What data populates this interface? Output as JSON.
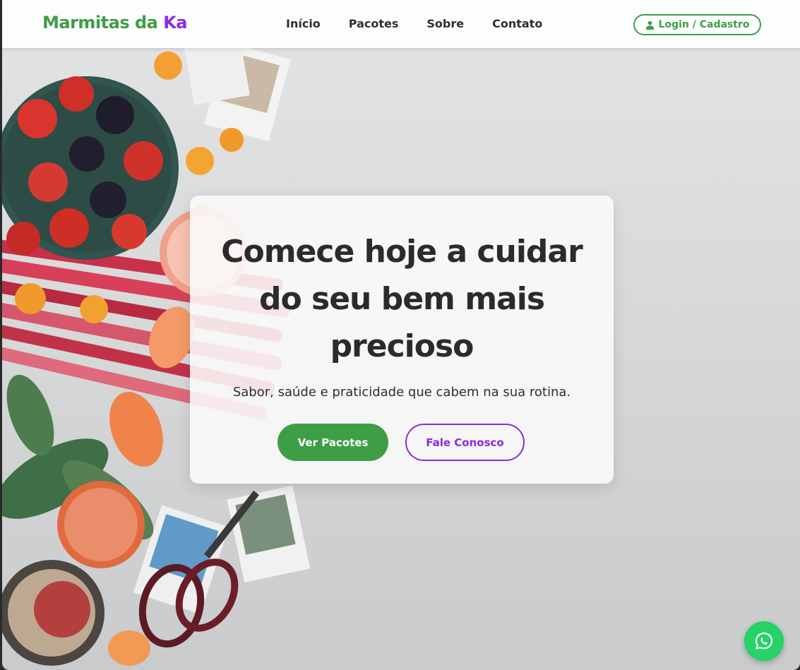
{
  "brand": {
    "name_part1": "Marmitas da ",
    "name_part2": "Ka"
  },
  "nav": {
    "links": [
      "Início",
      "Pacotes",
      "Sobre",
      "Contato"
    ],
    "login_label": "Login / Cadastro"
  },
  "hero": {
    "title": "Comece hoje a cuidar do seu bem mais precioso",
    "subtitle": "Sabor, saúde e praticidade que cabem na sua rotina.",
    "primary_cta": "Ver Pacotes",
    "secondary_cta": "Fale Conosco"
  },
  "floating": {
    "whatsapp_icon": "whatsapp-icon"
  },
  "colors": {
    "brand_green": "#3e9e46",
    "brand_purple": "#8a2be2",
    "whatsapp_green": "#25d366"
  }
}
